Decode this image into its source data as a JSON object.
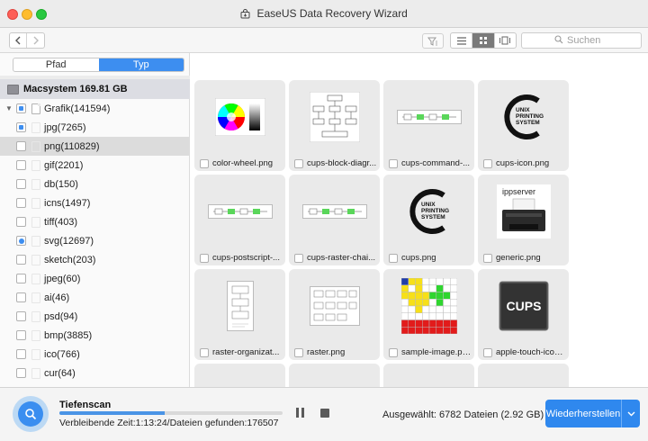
{
  "window": {
    "title": "EaseUS Data Recovery Wizard"
  },
  "toolbar": {
    "search_placeholder": "Suchen"
  },
  "sidebar": {
    "tabs": [
      {
        "label": "Pfad",
        "active": false
      },
      {
        "label": "Typ",
        "active": true
      }
    ],
    "drive_label": "Macsystem 169.81 GB",
    "group_label": "Grafik(141594)",
    "items": [
      {
        "label": "jpg(7265)",
        "check": "partial"
      },
      {
        "label": "png(110829)",
        "check": "none",
        "selected": true
      },
      {
        "label": "gif(2201)",
        "check": "none"
      },
      {
        "label": "db(150)",
        "check": "none"
      },
      {
        "label": "icns(1497)",
        "check": "none"
      },
      {
        "label": "tiff(403)",
        "check": "none"
      },
      {
        "label": "svg(12697)",
        "check": "dot"
      },
      {
        "label": "sketch(203)",
        "check": "none"
      },
      {
        "label": "jpeg(60)",
        "check": "none"
      },
      {
        "label": "ai(46)",
        "check": "none"
      },
      {
        "label": "psd(94)",
        "check": "none"
      },
      {
        "label": "bmp(3885)",
        "check": "none"
      },
      {
        "label": "ico(766)",
        "check": "none"
      },
      {
        "label": "cur(64)",
        "check": "none"
      }
    ]
  },
  "files": [
    {
      "name": "color-wheel.png",
      "thumb": "color-wheel"
    },
    {
      "name": "cups-block-diagr...",
      "thumb": "block-diagram"
    },
    {
      "name": "cups-command-...",
      "thumb": "flow-strip"
    },
    {
      "name": "cups-icon.png",
      "thumb": "unix-printing"
    },
    {
      "name": "cups-postscript-...",
      "thumb": "flow-strip"
    },
    {
      "name": "cups-raster-chai...",
      "thumb": "flow-strip"
    },
    {
      "name": "cups.png",
      "thumb": "unix-printing"
    },
    {
      "name": "generic.png",
      "thumb": "printer"
    },
    {
      "name": "raster-organizat...",
      "thumb": "raster-doc"
    },
    {
      "name": "raster.png",
      "thumb": "raster-grid"
    },
    {
      "name": "sample-image.png",
      "thumb": "sample-grid"
    },
    {
      "name": "apple-touch-icon...",
      "thumb": "cups-logo"
    }
  ],
  "thumb_text": {
    "unix_printing": [
      "UNIX",
      "PRINTING",
      "SYSTEM"
    ],
    "ippserver": "ippserver",
    "cups_logo": "CUPS"
  },
  "status": {
    "scan_title": "Tiefenscan",
    "scan_detail": "Verbleibende Zeit:1:13:24/Dateien gefunden:176507",
    "progress_fraction": 0.47,
    "selected_info": "Ausgewählt: 6782 Dateien (2.92 GB)",
    "recover_label": "Wiederherstellen"
  },
  "colors": {
    "accent": "#3d8ef0",
    "tile": "#eaeaea",
    "progress": "#4a94e6"
  }
}
